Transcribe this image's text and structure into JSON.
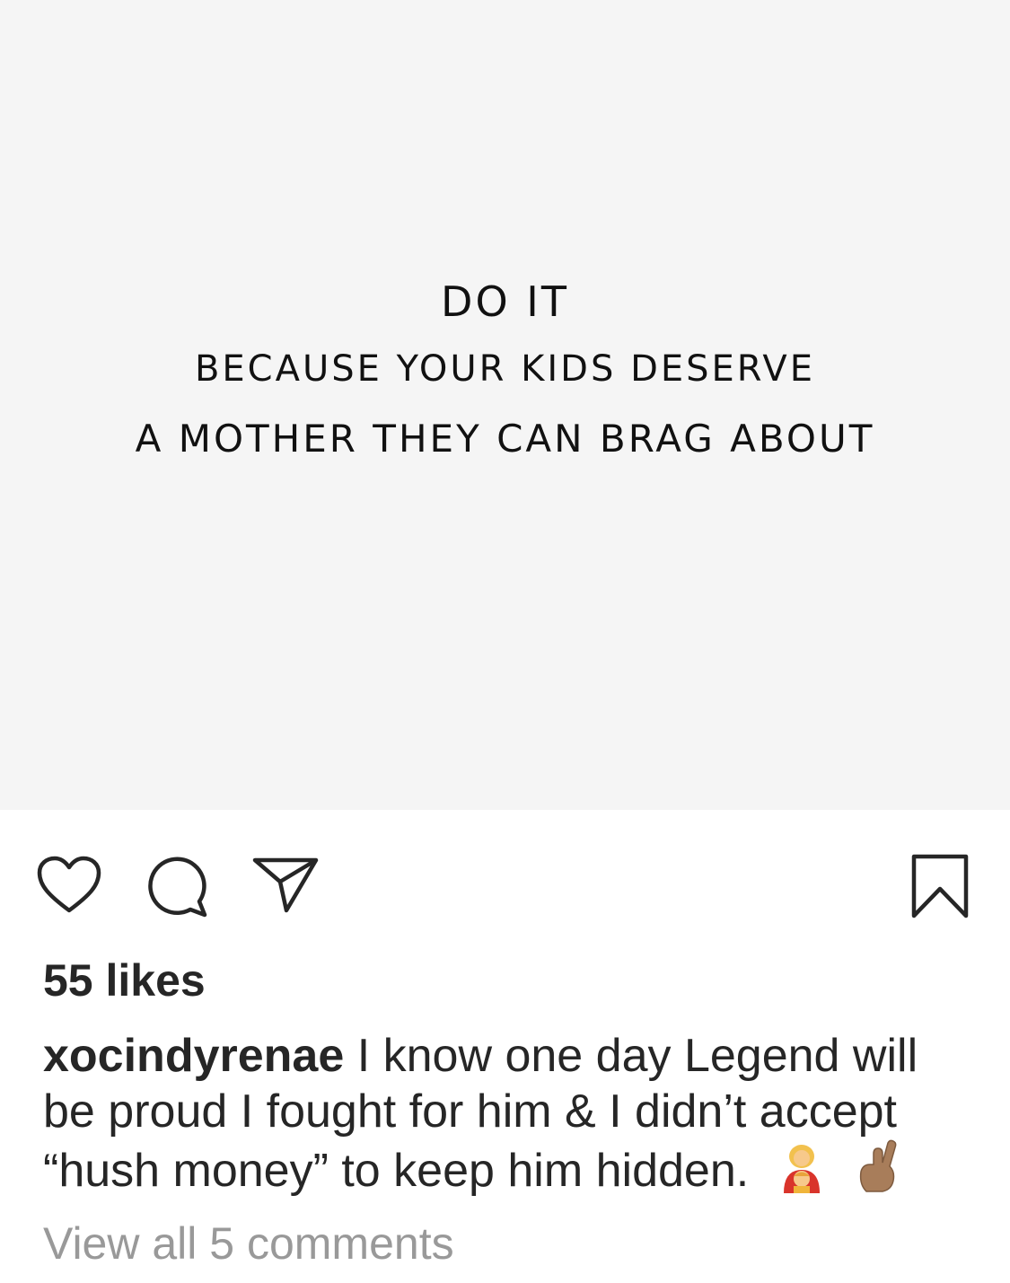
{
  "post": {
    "image_text": {
      "line1": "DO IT",
      "line2": "BECAUSE YOUR KIDS DESERVE",
      "line3": "A MOTHER THEY CAN BRAG ABOUT"
    },
    "likes": "55 likes",
    "caption": {
      "username": "xocindyrenae",
      "text": "I know one day Legend will be proud I fought for him & I didn’t accept “hush money” to keep him hidden."
    },
    "view_comments": "View all 5 comments"
  },
  "icons": [
    "heart-icon",
    "comment-icon",
    "share-icon",
    "bookmark-icon",
    "mother-child-emoji",
    "crossed-fingers-emoji"
  ],
  "colors": {
    "image_background": "#f5f5f5",
    "text_primary": "#262626",
    "text_muted": "#999999"
  }
}
